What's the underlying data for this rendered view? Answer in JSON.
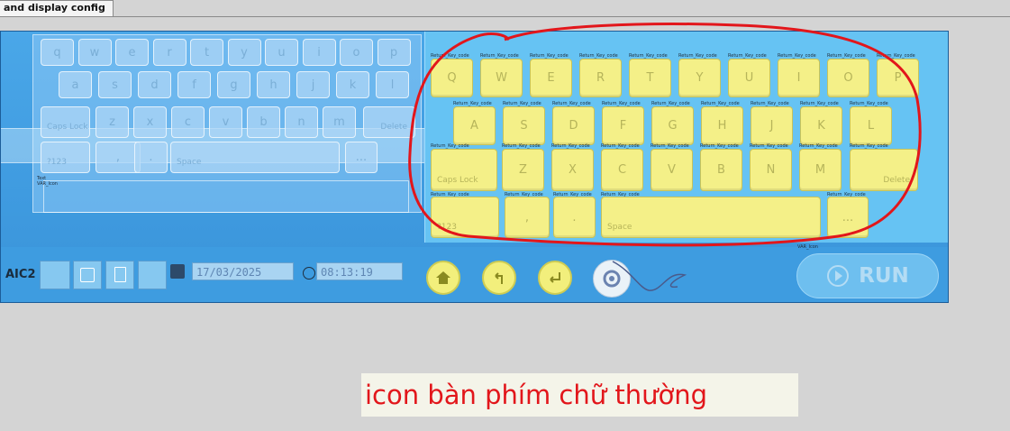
{
  "tab": {
    "label": "and display config"
  },
  "keyboard_lower": {
    "row1": [
      "q",
      "w",
      "e",
      "r",
      "t",
      "y",
      "u",
      "i",
      "o",
      "p"
    ],
    "row2": [
      "a",
      "s",
      "d",
      "f",
      "g",
      "h",
      "j",
      "k",
      "l"
    ],
    "row3": [
      "z",
      "x",
      "c",
      "v",
      "b",
      "n",
      "m"
    ],
    "caps": "Caps Lock",
    "delete": "Delete",
    "num": "?123",
    "comma": ",",
    "period": ".",
    "space": "Space",
    "dots": "...",
    "text_label": "Text",
    "icon_label": "VAR_Icon"
  },
  "keyboard_upper": {
    "row1": [
      "Q",
      "W",
      "E",
      "R",
      "T",
      "Y",
      "U",
      "I",
      "O",
      "P"
    ],
    "row2": [
      "A",
      "S",
      "D",
      "F",
      "G",
      "H",
      "J",
      "K",
      "L"
    ],
    "row3": [
      "Z",
      "X",
      "C",
      "V",
      "B",
      "N",
      "M"
    ],
    "caps": "Caps Lock",
    "delete": "Delete",
    "num": "?123",
    "comma": ",",
    "period": ".",
    "space": "Space",
    "dots": "...",
    "key_tag": "Return_Key_code"
  },
  "status": {
    "device": "AIC2",
    "date": "17/03/2025",
    "time": "08:13:19",
    "var_icon": "VAR_Icon",
    "rtc": "RTC"
  },
  "actions": {
    "home_icon": "home-icon",
    "back_icon": "back-arrow-icon",
    "enter_icon": "enter-icon",
    "settings_icon": "gear-icon",
    "run_label": "RUN"
  },
  "annotation": {
    "caption": "icon bàn phím chữ thường"
  }
}
